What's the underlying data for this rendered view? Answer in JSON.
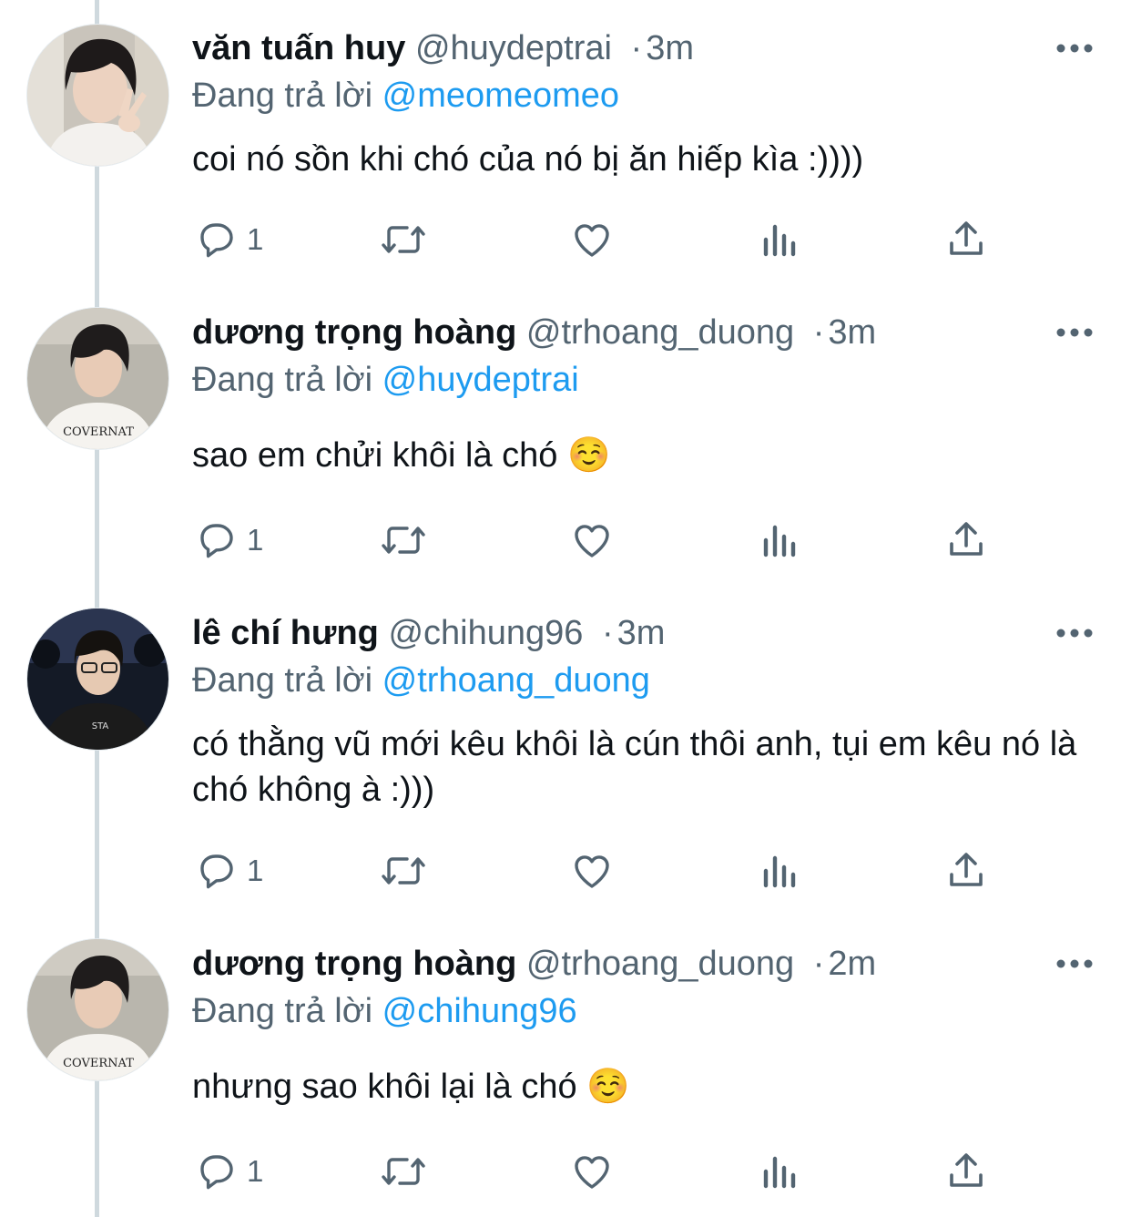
{
  "tweets": [
    {
      "name": "văn tuấn huy",
      "handle": "@huydeptrai",
      "time": "3m",
      "replying_label": "Đang trả lời",
      "replying_to": "@meomeomeo",
      "content": "coi nó sồn khi chó của nó bị ăn hiếp kìa :))))",
      "reply_count": "1"
    },
    {
      "name": "dương trọng hoàng",
      "handle": "@trhoang_duong",
      "time": "3m",
      "replying_label": "Đang trả lời",
      "replying_to": "@huydeptrai",
      "content": "sao em chửi khôi là chó ☺️",
      "reply_count": "1"
    },
    {
      "name": "lê chí hưng",
      "handle": "@chihung96",
      "time": "3m",
      "replying_label": "Đang trả lời",
      "replying_to": "@trhoang_duong",
      "content": "có thằng vũ mới kêu khôi là cún thôi anh, tụi em kêu nó là chó không à :)))",
      "reply_count": "1"
    },
    {
      "name": "dương trọng hoàng",
      "handle": "@trhoang_duong",
      "time": "2m",
      "replying_label": "Đang trả lời",
      "replying_to": "@chihung96",
      "content": "nhưng sao khôi lại là chó ☺️",
      "reply_count": "1"
    }
  ],
  "avatar_shirt_text": "COVERNAT",
  "avatar_badge_text": "STA",
  "colors": {
    "text": "#0f1419",
    "secondary": "#536471",
    "link": "#1d9bf0",
    "thread_line": "#cfd9de"
  },
  "icons": [
    "more-icon",
    "reply-icon",
    "retweet-icon",
    "like-icon",
    "views-icon",
    "share-icon"
  ]
}
